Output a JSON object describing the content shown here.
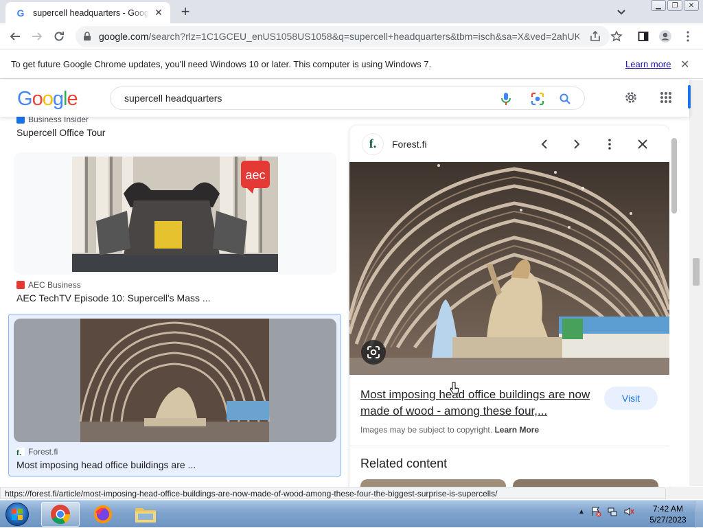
{
  "browser": {
    "tab_title": "supercell headquarters - Google Search",
    "url_host": "google.com",
    "url_rest": "/search?rlz=1C1GCEU_enUS1058US1058&q=supercell+headquarters&tbm=isch&sa=X&ved=2ahUK...",
    "status_url": "https://forest.fi/article/most-imposing-head-office-buildings-are-now-made-of-wood-among-these-four-the-biggest-surprise-is-supercells/"
  },
  "infobar": {
    "message": "To get future Google Chrome updates, you'll need Windows 10 or later. This computer is using Windows 7.",
    "learn_more": "Learn more"
  },
  "search": {
    "logo": [
      "G",
      "o",
      "o",
      "g",
      "l",
      "e"
    ],
    "logo_colors": [
      "#4285f4",
      "#ea4335",
      "#fbbc05",
      "#4285f4",
      "#34a853",
      "#ea4335"
    ],
    "query": "supercell headquarters"
  },
  "results": [
    {
      "source": "Business Insider",
      "title": "Supercell Office Tour",
      "fav_color": "#1a73e8"
    },
    {
      "source": "AEC Business",
      "title": "AEC TechTV Episode 10: Supercell's Mass ...",
      "fav_color": "#e53935",
      "badge": "aec"
    },
    {
      "source": "Forest.fi",
      "title": "Most imposing head office buildings are ...",
      "fav_color": "#0b5b3c",
      "selected": true
    }
  ],
  "panel": {
    "site": "Forest.fi",
    "site_initial": "f.",
    "title": "Most imposing head office buildings are now made of wood - among these four,...",
    "visit": "Visit",
    "copyright": "Images may be subject to copyright.",
    "copyright_link": "Learn More",
    "related": "Related content"
  },
  "taskbar": {
    "time": "7:42 AM",
    "date": "5/27/2023"
  }
}
